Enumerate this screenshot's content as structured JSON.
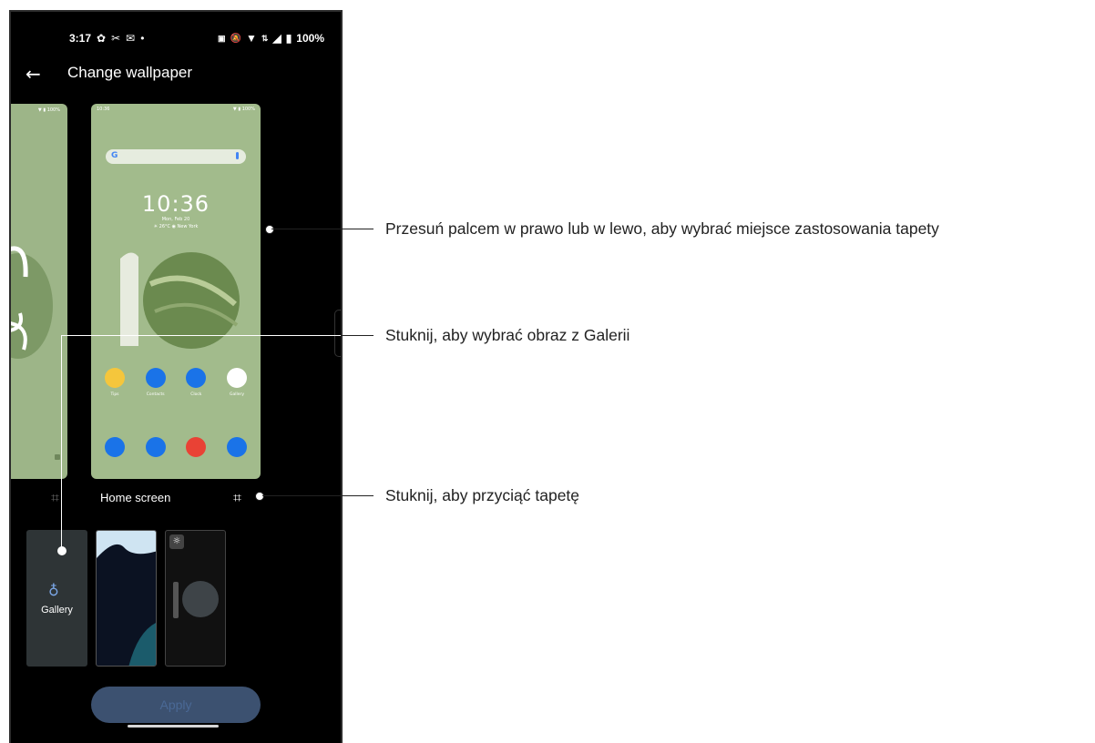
{
  "status_bar": {
    "time": "3:17",
    "battery": "100%"
  },
  "header": {
    "back_icon": "arrow-left-icon",
    "title": "Change wallpaper"
  },
  "preview": {
    "clock": "10:36",
    "date": "Mon, Feb 20",
    "weather": "☀ 26°C ◉ New York",
    "search_logo": "G",
    "caption": "Home screen",
    "apps_row1": [
      "Tips",
      "Contacts",
      "Clock",
      "Gallery"
    ],
    "apps_row1_colors": [
      "#f5c63c",
      "#1a73e8",
      "#1a73e8",
      "#ffffff"
    ],
    "apps_row2_colors": [
      "#1a73e8",
      "#1a73e8",
      "#e94235",
      "#1a73e8"
    ]
  },
  "thumbnails": {
    "gallery_label": "Gallery"
  },
  "apply_button": {
    "label": "Apply"
  },
  "callouts": {
    "swipe": "Przesuń palcem w prawo lub w lewo, aby wybrać miejsce zastosowania tapety",
    "gallery": "Stuknij, aby wybrać obraz z Galerii",
    "crop": "Stuknij, aby przyciąć tapetę"
  }
}
